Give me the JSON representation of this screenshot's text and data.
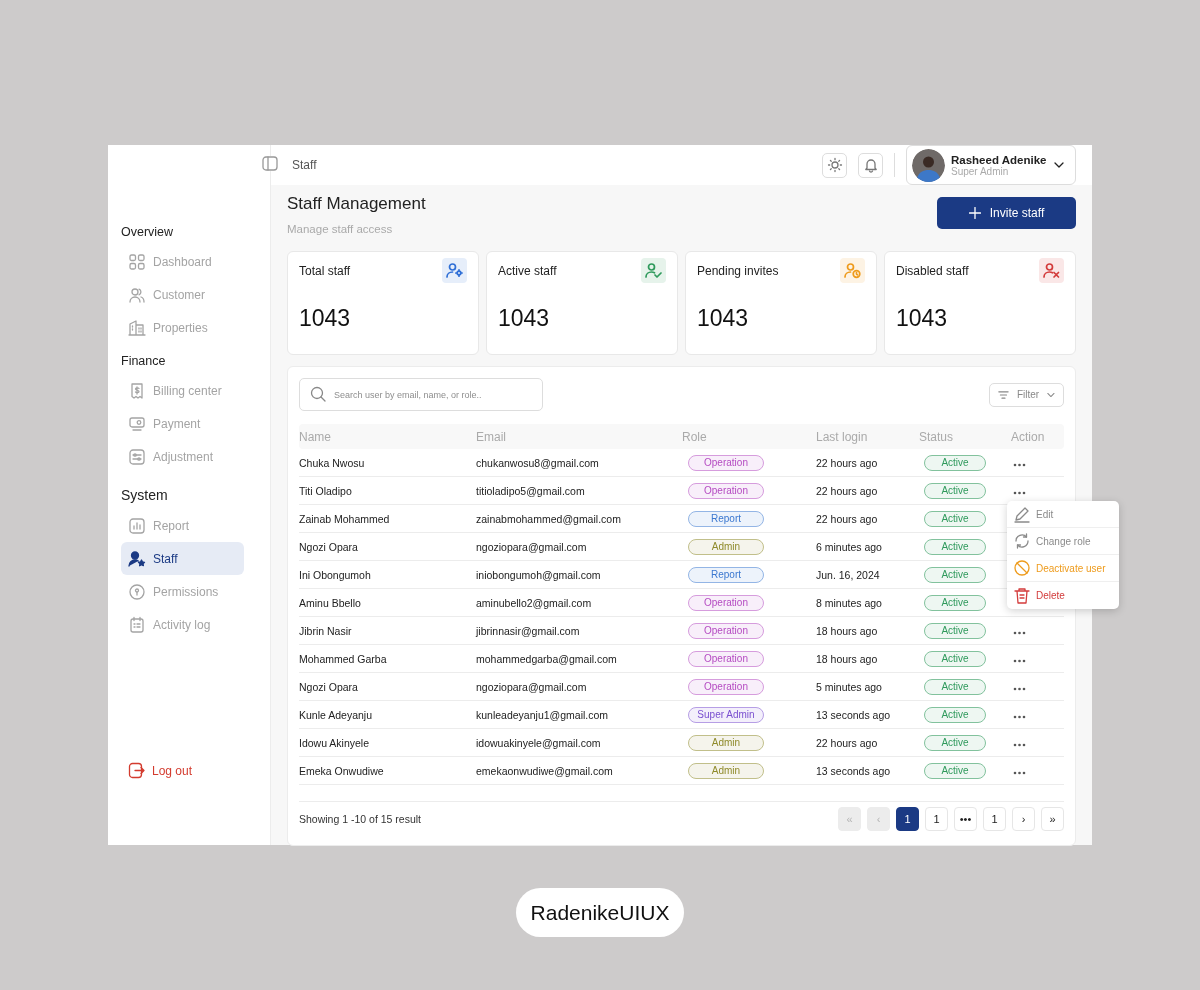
{
  "sidebar": {
    "sections": [
      {
        "title": "Overview",
        "items": [
          {
            "label": "Dashboard",
            "kind": "dashboard",
            "selected": false
          },
          {
            "label": "Customer",
            "kind": "customer",
            "selected": false
          },
          {
            "label": "Properties",
            "kind": "properties",
            "selected": false
          }
        ]
      },
      {
        "title": "Finance",
        "items": [
          {
            "label": "Billing center",
            "kind": "billing",
            "selected": false
          },
          {
            "label": "Payment",
            "kind": "payment",
            "selected": false
          },
          {
            "label": "Adjustment",
            "kind": "adjustment",
            "selected": false
          }
        ]
      },
      {
        "title": "System",
        "items": [
          {
            "label": "Report",
            "kind": "report",
            "selected": false
          },
          {
            "label": "Staff",
            "kind": "staff",
            "selected": true
          },
          {
            "label": "Permissions",
            "kind": "permissions",
            "selected": false
          },
          {
            "label": "Activity log",
            "kind": "activity",
            "selected": false
          }
        ]
      }
    ],
    "logout": "Log out"
  },
  "topbar": {
    "breadcrumb": "Staff",
    "user": {
      "name": "Rasheed Adenike",
      "role": "Super Admin"
    }
  },
  "header": {
    "title": "Staff Management",
    "subtitle": "Manage staff access",
    "invite_button": "Invite staff"
  },
  "stats": [
    {
      "label": "Total staff",
      "value": "1043",
      "kind": "total",
      "color": "#2f6fd6"
    },
    {
      "label": "Active staff",
      "value": "1043",
      "kind": "active",
      "color": "#2f9a5c"
    },
    {
      "label": "Pending invites",
      "value": "1043",
      "kind": "pending",
      "color": "#ee9b1c"
    },
    {
      "label": "Disabled staff",
      "value": "1043",
      "kind": "disabled",
      "color": "#d33b3b"
    }
  ],
  "table": {
    "search": {
      "placeholder": "Search user by email, name, or role.."
    },
    "filter": "Filter",
    "columns": [
      "Name",
      "Email",
      "Role",
      "Last login",
      "Status",
      "Action"
    ],
    "rows": [
      {
        "name": "Chuka Nwosu",
        "email": "chukanwosu8@gmail.com",
        "role": {
          "label": "Operation",
          "color": "#b54bc2"
        },
        "last_login": "22 hours ago",
        "status": {
          "label": "Active",
          "color": "#2f9a5c"
        },
        "menu_open": false
      },
      {
        "name": "Titi Oladipo",
        "email": "titioladipo5@gmail.com",
        "role": {
          "label": "Operation",
          "color": "#b54bc2"
        },
        "last_login": "22 hours ago",
        "status": {
          "label": "Active",
          "color": "#2f9a5c"
        },
        "menu_open": true
      },
      {
        "name": "Zainab Mohammed",
        "email": "zainabmohammed@gmail.com",
        "role": {
          "label": "Report",
          "color": "#3b78d0"
        },
        "last_login": "22 hours ago",
        "status": {
          "label": "Active",
          "color": "#2f9a5c"
        },
        "menu_open": false
      },
      {
        "name": "Ngozi Opara",
        "email": "ngoziopara@gmail.com",
        "role": {
          "label": "Admin",
          "color": "#8f8a2a"
        },
        "last_login": "6 minutes ago",
        "status": {
          "label": "Active",
          "color": "#2f9a5c"
        },
        "menu_open": false
      },
      {
        "name": "Ini Obongumoh",
        "email": "iniobongumoh@gmail.com",
        "role": {
          "label": "Report",
          "color": "#3b78d0"
        },
        "last_login": "Jun. 16, 2024",
        "status": {
          "label": "Active",
          "color": "#2f9a5c"
        },
        "menu_open": false
      },
      {
        "name": "Aminu Bbello",
        "email": "aminubello2@gmail.com",
        "role": {
          "label": "Operation",
          "color": "#b54bc2"
        },
        "last_login": "8 minutes ago",
        "status": {
          "label": "Active",
          "color": "#2f9a5c"
        },
        "menu_open": false
      },
      {
        "name": "Jibrin Nasir",
        "email": "jibrinnasir@gmail.com",
        "role": {
          "label": "Operation",
          "color": "#b54bc2"
        },
        "last_login": "18 hours ago",
        "status": {
          "label": "Active",
          "color": "#2f9a5c"
        },
        "menu_open": false
      },
      {
        "name": "Mohammed Garba",
        "email": "mohammedgarba@gmail.com",
        "role": {
          "label": "Operation",
          "color": "#b54bc2"
        },
        "last_login": "18 hours ago",
        "status": {
          "label": "Active",
          "color": "#2f9a5c"
        },
        "menu_open": false
      },
      {
        "name": "Ngozi Opara",
        "email": "ngoziopara@gmail.com",
        "role": {
          "label": "Operation",
          "color": "#b54bc2"
        },
        "last_login": "5 minutes ago",
        "status": {
          "label": "Active",
          "color": "#2f9a5c"
        },
        "menu_open": false
      },
      {
        "name": "Kunle Adeyanju",
        "email": "kunleadeyanju1@gmail.com",
        "role": {
          "label": "Super Admin",
          "color": "#7a4fd0"
        },
        "last_login": "13 seconds ago",
        "status": {
          "label": "Active",
          "color": "#2f9a5c"
        },
        "menu_open": false
      },
      {
        "name": "Idowu Akinyele",
        "email": "idowuakinyele@gmail.com",
        "role": {
          "label": "Admin",
          "color": "#8f8a2a"
        },
        "last_login": "22 hours ago",
        "status": {
          "label": "Active",
          "color": "#2f9a5c"
        },
        "menu_open": false
      },
      {
        "name": "Emeka Onwudiwe",
        "email": "emekaonwudiwe@gmail.com",
        "role": {
          "label": "Admin",
          "color": "#8f8a2a"
        },
        "last_login": "13 seconds ago",
        "status": {
          "label": "Active",
          "color": "#2f9a5c"
        },
        "menu_open": false
      }
    ],
    "menu": [
      {
        "label": "Edit",
        "kind": "edit",
        "color": "#8a8a8a"
      },
      {
        "label": "Change role",
        "kind": "role",
        "color": "#8a8a8a"
      },
      {
        "label": "Deactivate user",
        "kind": "deactivate",
        "color": "#ee9b1c"
      },
      {
        "label": "Delete",
        "kind": "delete",
        "color": "#d33b3b"
      }
    ],
    "footer": "Showing 1 -10 of 15 result",
    "pages": [
      {
        "label": "«",
        "selected": false,
        "disabled": true
      },
      {
        "label": "‹",
        "selected": false,
        "disabled": true
      },
      {
        "label": "1",
        "selected": true,
        "disabled": false
      },
      {
        "label": "1",
        "selected": false,
        "disabled": false
      },
      {
        "label": "•••",
        "selected": false,
        "disabled": false
      },
      {
        "label": "1",
        "selected": false,
        "disabled": false
      },
      {
        "label": "›",
        "selected": false,
        "disabled": false
      },
      {
        "label": "»",
        "selected": false,
        "disabled": false
      }
    ]
  },
  "brand": "RadenikeUIUX"
}
